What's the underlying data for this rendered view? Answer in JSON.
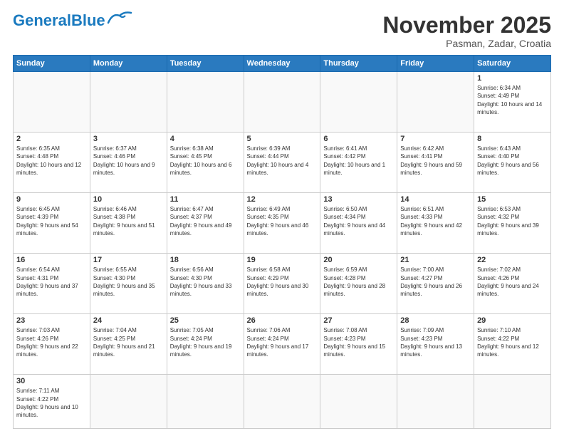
{
  "header": {
    "logo_general": "General",
    "logo_blue": "Blue",
    "month_title": "November 2025",
    "subtitle": "Pasman, Zadar, Croatia"
  },
  "weekdays": [
    "Sunday",
    "Monday",
    "Tuesday",
    "Wednesday",
    "Thursday",
    "Friday",
    "Saturday"
  ],
  "days": {
    "d1": {
      "num": "1",
      "rise": "6:34 AM",
      "set": "4:49 PM",
      "daylight": "10 hours and 14 minutes."
    },
    "d2": {
      "num": "2",
      "rise": "6:35 AM",
      "set": "4:48 PM",
      "daylight": "10 hours and 12 minutes."
    },
    "d3": {
      "num": "3",
      "rise": "6:37 AM",
      "set": "4:46 PM",
      "daylight": "10 hours and 9 minutes."
    },
    "d4": {
      "num": "4",
      "rise": "6:38 AM",
      "set": "4:45 PM",
      "daylight": "10 hours and 6 minutes."
    },
    "d5": {
      "num": "5",
      "rise": "6:39 AM",
      "set": "4:44 PM",
      "daylight": "10 hours and 4 minutes."
    },
    "d6": {
      "num": "6",
      "rise": "6:41 AM",
      "set": "4:42 PM",
      "daylight": "10 hours and 1 minute."
    },
    "d7": {
      "num": "7",
      "rise": "6:42 AM",
      "set": "4:41 PM",
      "daylight": "9 hours and 59 minutes."
    },
    "d8": {
      "num": "8",
      "rise": "6:43 AM",
      "set": "4:40 PM",
      "daylight": "9 hours and 56 minutes."
    },
    "d9": {
      "num": "9",
      "rise": "6:45 AM",
      "set": "4:39 PM",
      "daylight": "9 hours and 54 minutes."
    },
    "d10": {
      "num": "10",
      "rise": "6:46 AM",
      "set": "4:38 PM",
      "daylight": "9 hours and 51 minutes."
    },
    "d11": {
      "num": "11",
      "rise": "6:47 AM",
      "set": "4:37 PM",
      "daylight": "9 hours and 49 minutes."
    },
    "d12": {
      "num": "12",
      "rise": "6:49 AM",
      "set": "4:35 PM",
      "daylight": "9 hours and 46 minutes."
    },
    "d13": {
      "num": "13",
      "rise": "6:50 AM",
      "set": "4:34 PM",
      "daylight": "9 hours and 44 minutes."
    },
    "d14": {
      "num": "14",
      "rise": "6:51 AM",
      "set": "4:33 PM",
      "daylight": "9 hours and 42 minutes."
    },
    "d15": {
      "num": "15",
      "rise": "6:53 AM",
      "set": "4:32 PM",
      "daylight": "9 hours and 39 minutes."
    },
    "d16": {
      "num": "16",
      "rise": "6:54 AM",
      "set": "4:31 PM",
      "daylight": "9 hours and 37 minutes."
    },
    "d17": {
      "num": "17",
      "rise": "6:55 AM",
      "set": "4:30 PM",
      "daylight": "9 hours and 35 minutes."
    },
    "d18": {
      "num": "18",
      "rise": "6:56 AM",
      "set": "4:30 PM",
      "daylight": "9 hours and 33 minutes."
    },
    "d19": {
      "num": "19",
      "rise": "6:58 AM",
      "set": "4:29 PM",
      "daylight": "9 hours and 30 minutes."
    },
    "d20": {
      "num": "20",
      "rise": "6:59 AM",
      "set": "4:28 PM",
      "daylight": "9 hours and 28 minutes."
    },
    "d21": {
      "num": "21",
      "rise": "7:00 AM",
      "set": "4:27 PM",
      "daylight": "9 hours and 26 minutes."
    },
    "d22": {
      "num": "22",
      "rise": "7:02 AM",
      "set": "4:26 PM",
      "daylight": "9 hours and 24 minutes."
    },
    "d23": {
      "num": "23",
      "rise": "7:03 AM",
      "set": "4:26 PM",
      "daylight": "9 hours and 22 minutes."
    },
    "d24": {
      "num": "24",
      "rise": "7:04 AM",
      "set": "4:25 PM",
      "daylight": "9 hours and 21 minutes."
    },
    "d25": {
      "num": "25",
      "rise": "7:05 AM",
      "set": "4:24 PM",
      "daylight": "9 hours and 19 minutes."
    },
    "d26": {
      "num": "26",
      "rise": "7:06 AM",
      "set": "4:24 PM",
      "daylight": "9 hours and 17 minutes."
    },
    "d27": {
      "num": "27",
      "rise": "7:08 AM",
      "set": "4:23 PM",
      "daylight": "9 hours and 15 minutes."
    },
    "d28": {
      "num": "28",
      "rise": "7:09 AM",
      "set": "4:23 PM",
      "daylight": "9 hours and 13 minutes."
    },
    "d29": {
      "num": "29",
      "rise": "7:10 AM",
      "set": "4:22 PM",
      "daylight": "9 hours and 12 minutes."
    },
    "d30": {
      "num": "30",
      "rise": "7:11 AM",
      "set": "4:22 PM",
      "daylight": "9 hours and 10 minutes."
    }
  }
}
